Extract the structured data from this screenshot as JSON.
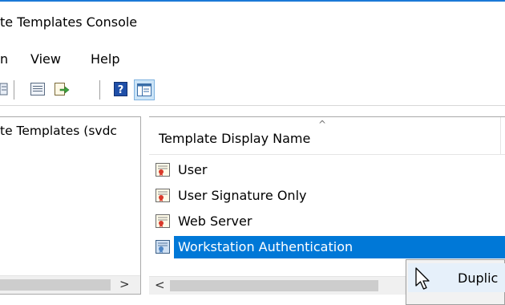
{
  "window": {
    "title": "te Templates Console"
  },
  "menu": {
    "items": [
      "n",
      "View",
      "Help"
    ]
  },
  "toolbar": {
    "icons": [
      "properties-icon",
      "list-icon",
      "export-icon",
      "help-icon",
      "show-hide-pane-icon"
    ]
  },
  "left_pane": {
    "node_label": "te Templates (svdc"
  },
  "list": {
    "column_header": "Template Display Name",
    "rows": [
      {
        "label": "User",
        "selected": false
      },
      {
        "label": "User Signature Only",
        "selected": false
      },
      {
        "label": "Web Server",
        "selected": false
      },
      {
        "label": "Workstation Authentication",
        "selected": true
      }
    ]
  },
  "context_menu": {
    "item_label": "Duplic"
  },
  "scroll": {
    "left_arrow": "<",
    "right_arrow": ">"
  },
  "colors": {
    "selection": "#0078d7",
    "title_accent": "#1b79d7",
    "context_hover": "#e6f0fa"
  }
}
